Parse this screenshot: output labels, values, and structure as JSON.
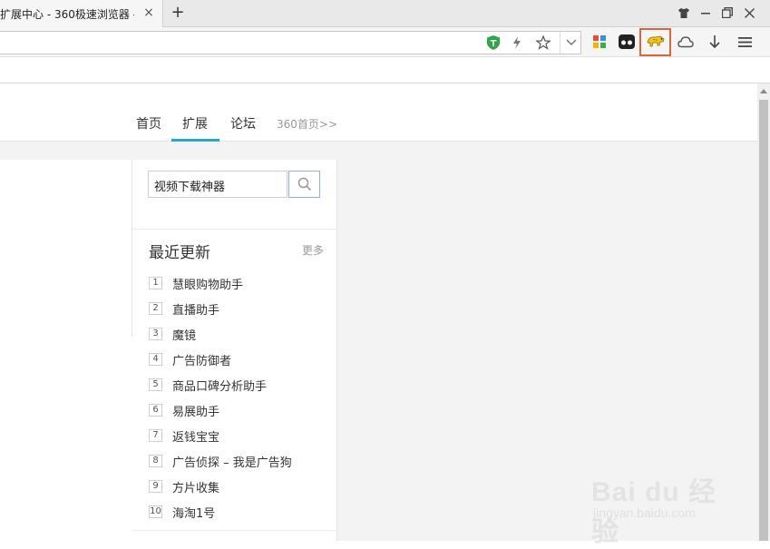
{
  "tab": {
    "title": "扩展中心 - 360极速浏览器 - ",
    "close": "×",
    "new_tab": "+"
  },
  "window_controls": [
    "skin-icon",
    "maximize-icon",
    "restore-icon",
    "close-icon"
  ],
  "address_bar": {
    "value": "",
    "icons": [
      "ad-shield-icon",
      "lightning-icon",
      "star-icon",
      "chevron-down-icon"
    ]
  },
  "toolbar_icons": [
    "app-grid-icon",
    "mask-icon",
    "cheetah-extension-icon",
    "cloud-icon",
    "download-icon",
    "menu-icon"
  ],
  "accent_colors": {
    "nav_underline": "#22aacc",
    "highlight_border": "#e0643a",
    "search_button_border": "#8fb3d6"
  },
  "nav": {
    "home": "首页",
    "extensions": "扩展",
    "forum": "论坛",
    "home360": "360首页>>"
  },
  "search": {
    "value": "视频下载神器"
  },
  "recent": {
    "title": "最近更新",
    "more": "更多",
    "items": [
      {
        "num": "1",
        "label": "慧眼购物助手"
      },
      {
        "num": "2",
        "label": "直播助手"
      },
      {
        "num": "3",
        "label": "魔镜"
      },
      {
        "num": "4",
        "label": "广告防御者"
      },
      {
        "num": "5",
        "label": "商品口碑分析助手"
      },
      {
        "num": "6",
        "label": "易展助手"
      },
      {
        "num": "7",
        "label": "返钱宝宝"
      },
      {
        "num": "8",
        "label": "广告侦探 – 我是广告狗"
      },
      {
        "num": "9",
        "label": "方片收集"
      },
      {
        "num": "10",
        "label": "海淘1号"
      }
    ]
  },
  "watermark": {
    "brand": "Bai du 经验",
    "url": "jingyan.baidu.com"
  }
}
